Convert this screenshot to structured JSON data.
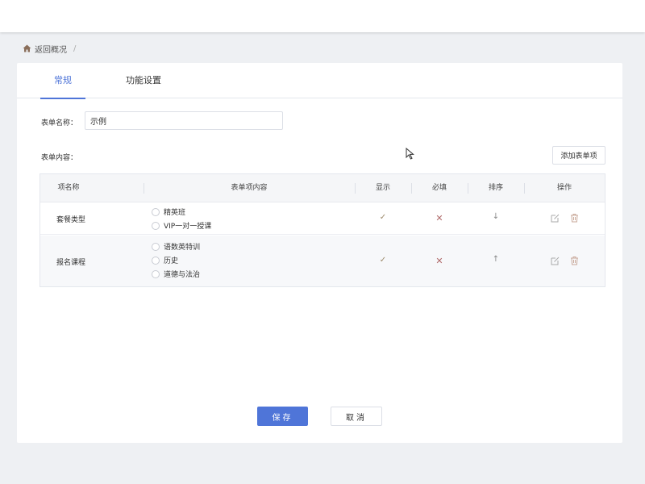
{
  "breadcrumb": {
    "home_label": "返回概况",
    "separator": "/"
  },
  "tabs": [
    {
      "label": "常规",
      "active": true
    },
    {
      "label": "功能设置",
      "active": false
    }
  ],
  "form": {
    "name_label": "表单名称：",
    "name_value": "示例",
    "content_label": "表单内容：",
    "add_button": "添加表单项"
  },
  "table": {
    "headers": [
      "项名称",
      "表单项内容",
      "显示",
      "必填",
      "排序",
      "操作"
    ],
    "rows": [
      {
        "name": "套餐类型",
        "options": [
          "精英班",
          "VIP一对一授课"
        ],
        "display": "✓",
        "required": "✕",
        "sort": "↓"
      },
      {
        "name": "报名课程",
        "options": [
          "语数英特训",
          "历史",
          "道德与法治"
        ],
        "display": "✓",
        "required": "✕",
        "sort": "↑"
      }
    ]
  },
  "actions": {
    "save": "保存",
    "cancel": "取消"
  },
  "colors": {
    "accent": "#4f75d8",
    "check": "#9c8a6a",
    "cross": "#b06a6a"
  },
  "icons": [
    "home-icon",
    "edit-icon",
    "trash-icon",
    "cursor-icon"
  ]
}
